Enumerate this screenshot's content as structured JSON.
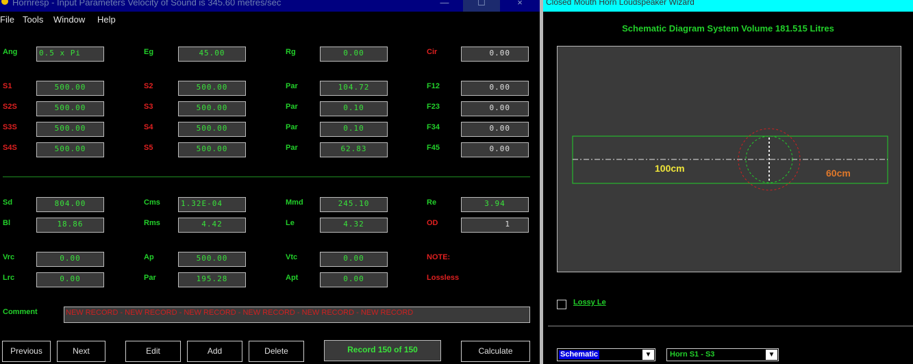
{
  "left_window": {
    "title": "Hornresp - Input Parameters   Velocity of Sound is 345.60 metres/sec",
    "minimize": "—",
    "maximize": "☐",
    "close": "×",
    "menu": [
      "File",
      "Tools",
      "Window",
      "Help"
    ],
    "fields": {
      "ang": {
        "label": "Ang",
        "value": "0.5 x Pi"
      },
      "eg": {
        "label": "Eg",
        "value": "45.00"
      },
      "rg": {
        "label": "Rg",
        "value": "0.00"
      },
      "cir": {
        "label": "Cir",
        "value": "0.00"
      },
      "s1": {
        "label": "S1",
        "value": "500.00"
      },
      "s2": {
        "label": "S2",
        "value": "500.00"
      },
      "par1": {
        "label": "Par",
        "value": "104.72"
      },
      "f12": {
        "label": "F12",
        "value": "0.00"
      },
      "s2s": {
        "label": "S2S",
        "value": "500.00"
      },
      "s3": {
        "label": "S3",
        "value": "500.00"
      },
      "par2": {
        "label": "Par",
        "value": "0.10"
      },
      "f23": {
        "label": "F23",
        "value": "0.00"
      },
      "s3s": {
        "label": "S3S",
        "value": "500.00"
      },
      "s4": {
        "label": "S4",
        "value": "500.00"
      },
      "par3": {
        "label": "Par",
        "value": "0.10"
      },
      "f34": {
        "label": "F34",
        "value": "0.00"
      },
      "s4s": {
        "label": "S4S",
        "value": "500.00"
      },
      "s5": {
        "label": "S5",
        "value": "500.00"
      },
      "par4": {
        "label": "Par",
        "value": "62.83"
      },
      "f45": {
        "label": "F45",
        "value": "0.00"
      },
      "sd": {
        "label": "Sd",
        "value": "804.00"
      },
      "cms": {
        "label": "Cms",
        "value": "1.32E-04"
      },
      "mmd": {
        "label": "Mmd",
        "value": "245.10"
      },
      "re": {
        "label": "Re",
        "value": "3.94"
      },
      "bl": {
        "label": "Bl",
        "value": "18.86"
      },
      "rms": {
        "label": "Rms",
        "value": "4.42"
      },
      "le": {
        "label": "Le",
        "value": "4.32"
      },
      "od": {
        "label": "OD",
        "value": "1"
      },
      "vrc": {
        "label": "Vrc",
        "value": "0.00"
      },
      "ap": {
        "label": "Ap",
        "value": "500.00"
      },
      "vtc": {
        "label": "Vtc",
        "value": "0.00"
      },
      "lrc": {
        "label": "Lrc",
        "value": "0.00"
      },
      "par5": {
        "label": "Par",
        "value": "195.28"
      },
      "apt": {
        "label": "Apt",
        "value": "0.00"
      }
    },
    "note_label": "NOTE:",
    "note_value": "Lossless",
    "comment_label": "Comment",
    "comment_value": "NEW RECORD - NEW RECORD - NEW RECORD - NEW RECORD - NEW RECORD - NEW RECORD",
    "buttons": {
      "previous": "Previous",
      "next": "Next",
      "edit": "Edit",
      "add": "Add",
      "delete": "Delete",
      "calculate": "Calculate"
    },
    "record": "Record 150 of 150"
  },
  "right_window": {
    "title": "Closed Mouth Horn Loudspeaker Wizard",
    "schematic_title": "Schematic Diagram   System Volume 181.515 Litres",
    "dim_left": "100cm",
    "dim_right": "60cm",
    "lossy_label": "Lossy Le",
    "combo_view": "Schematic",
    "combo_horn": "Horn S1 - S3"
  },
  "colors": {
    "label_green": "#22d02a",
    "label_red": "#e02020",
    "value_green": "#39e33a",
    "field_bg": "#3a3a3a",
    "title_left": "#000080",
    "title_right": "#00ffff",
    "dim_yellow": "#f0e63a",
    "dim_orange": "#e0782a"
  }
}
